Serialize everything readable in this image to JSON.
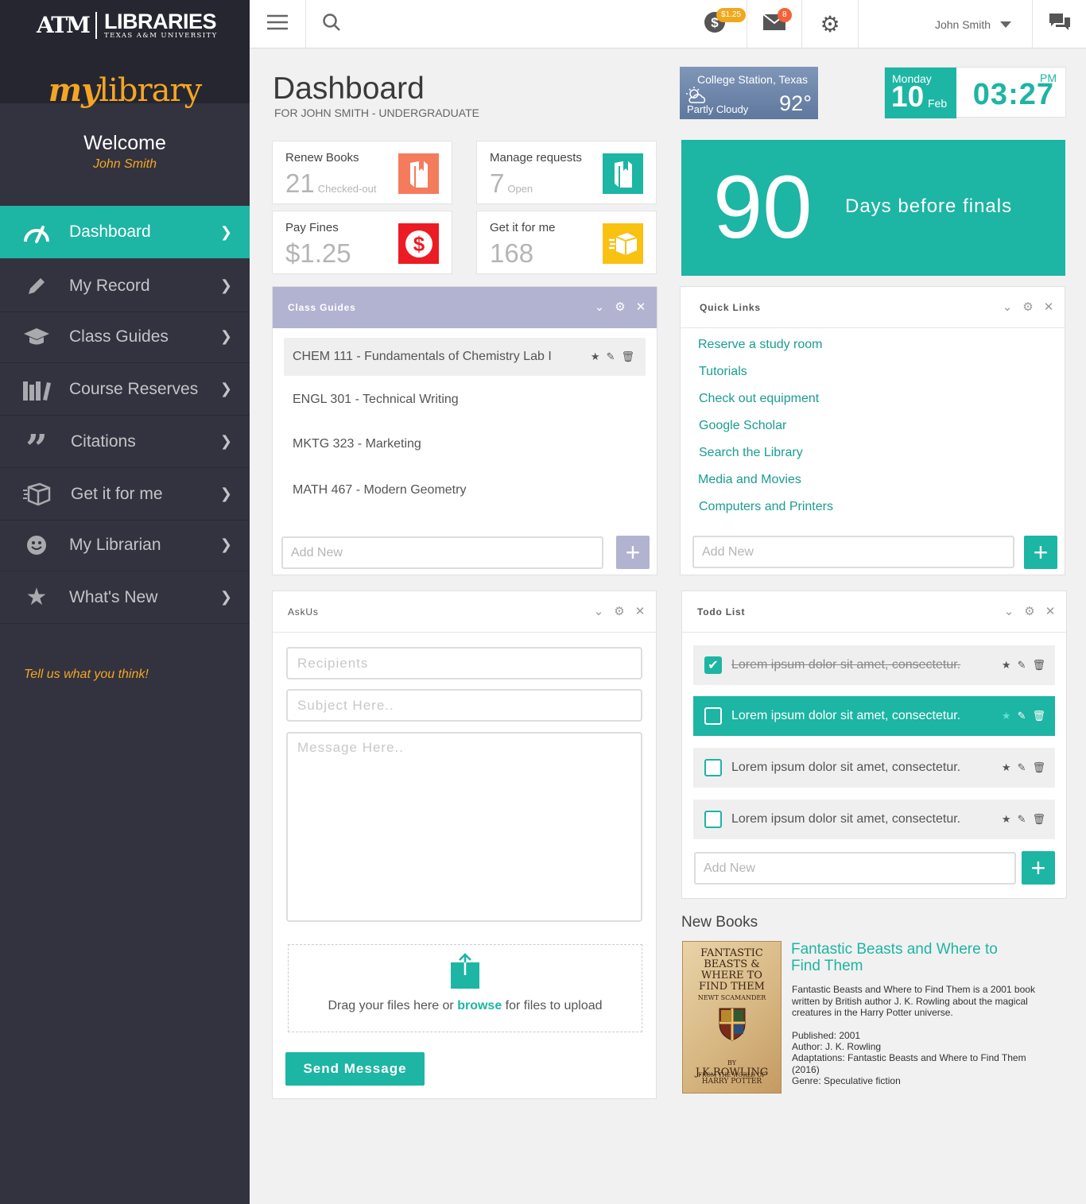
{
  "brand": {
    "logo_mark": "ATM",
    "logo_libraries": "LIBRARIES",
    "logo_university": "TEXAS A&M UNIVERSITY",
    "app_my": "my",
    "app_library": "library"
  },
  "sidebar": {
    "welcome": "Welcome",
    "user": "John Smith",
    "items": [
      {
        "label": "Dashboard",
        "icon": "speedometer-icon"
      },
      {
        "label": "My Record",
        "icon": "pencil-icon"
      },
      {
        "label": "Class Guides",
        "icon": "graduation-cap-icon"
      },
      {
        "label": "Course Reserves",
        "icon": "books-icon"
      },
      {
        "label": "Citations",
        "icon": "quote-icon"
      },
      {
        "label": "Get it for me",
        "icon": "package-icon"
      },
      {
        "label": "My Librarian",
        "icon": "smiley-icon"
      },
      {
        "label": "What's New",
        "icon": "star-icon"
      }
    ],
    "feedback": "Tell us what you think!"
  },
  "topbar": {
    "fines_badge": "$1.25",
    "messages_badge": "8",
    "user": "John Smith"
  },
  "header": {
    "title": "Dashboard",
    "subtitle": "FOR JOHN SMITH - UNDERGRADUATE"
  },
  "weather": {
    "location": "College Station, Texas",
    "condition": "Partly Cloudy",
    "temp": "92°"
  },
  "clock": {
    "day": "Monday",
    "date": "10",
    "month": "Feb",
    "ampm": "PM",
    "time": "03:27"
  },
  "stats": [
    {
      "title": "Renew Books",
      "value": "21",
      "unit": "Checked-out",
      "color": "#f47c5c"
    },
    {
      "title": "Manage requests",
      "value": "7",
      "unit": "Open",
      "color": "#1db5a3"
    },
    {
      "title": "Pay Fines",
      "value": "$1.25",
      "unit": "",
      "color": "#ec1c24"
    },
    {
      "title": "Get it for me",
      "value": "168",
      "unit": "",
      "color": "#f9c112"
    }
  ],
  "finals": {
    "days": "90",
    "label": "Days before finals"
  },
  "class_guides": {
    "title": "Class Guides",
    "items": [
      "CHEM 111 - Fundamentals of Chemistry Lab I",
      "ENGL 301 - Technical Writing",
      "MKTG 323 - Marketing",
      "MATH 467 - Modern Geometry"
    ],
    "add_placeholder": "Add New"
  },
  "quick_links": {
    "title": "Quick Links",
    "items": [
      "Reserve a study room",
      "Tutorials",
      "Check out equipment",
      "Google Scholar",
      "Search the Library",
      "Media and Movies",
      "Computers and Printers"
    ],
    "add_placeholder": "Add New"
  },
  "askus": {
    "title": "AskUs",
    "recipients_placeholder": "Recipients",
    "subject_placeholder": "Subject Here..",
    "message_placeholder": "Message Here..",
    "drop_pre": "Drag your files here or ",
    "drop_link": "browse",
    "drop_post": " for files to upload",
    "send": "Send Message"
  },
  "todo": {
    "title": "Todo List",
    "items": [
      {
        "text": "Lorem ipsum dolor sit amet, consectetur.",
        "done": true
      },
      {
        "text": "Lorem ipsum dolor sit amet, consectetur.",
        "done": false
      },
      {
        "text": "Lorem ipsum dolor sit amet, consectetur.",
        "done": false
      },
      {
        "text": "Lorem ipsum dolor sit amet, consectetur.",
        "done": false
      }
    ],
    "add_placeholder": "Add New"
  },
  "new_books": {
    "heading": "New Books",
    "cover": {
      "line1": "FANTASTIC",
      "line2": "BEASTS &",
      "line3": "WHERE TO",
      "line4": "FIND THEM",
      "line5": "NEWT SCAMANDER",
      "line6": "BY",
      "line7": "J.K.ROWLING",
      "line8": "FROM THE WORLD OF",
      "line9": "HARRY POTTER"
    },
    "title": "Fantastic Beasts and Where to Find Them",
    "description": "Fantastic Beasts and Where to Find Them is a 2001 book written by British author J. K. Rowling about the magical creatures in the Harry Potter universe.",
    "published": "Published: 2001",
    "author": "Author: J. K. Rowling",
    "adaptations": "Adaptations: Fantastic Beasts and Where to Find Them (2016)",
    "genre": "Genre: Speculative fiction"
  }
}
